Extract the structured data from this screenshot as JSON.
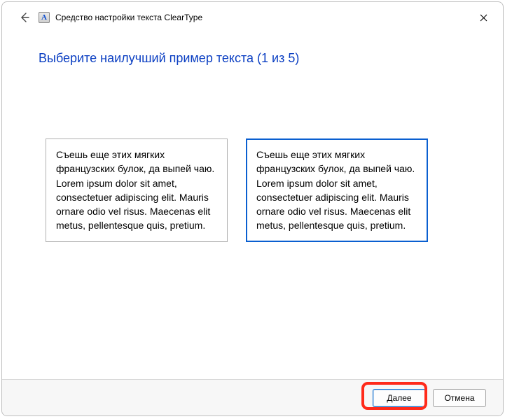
{
  "window": {
    "title": "Средство настройки текста ClearType"
  },
  "heading": "Выберите наилучший пример текста (1 из 5)",
  "sample_text": "Съешь еще этих мягких французских булок, да выпей чаю. Lorem ipsum dolor sit amet, consectetuer adipiscing elit. Mauris ornare odio vel risus. Maecenas elit metus, pellentesque quis, pretium.",
  "footer": {
    "next": "Далее",
    "cancel": "Отмена"
  }
}
